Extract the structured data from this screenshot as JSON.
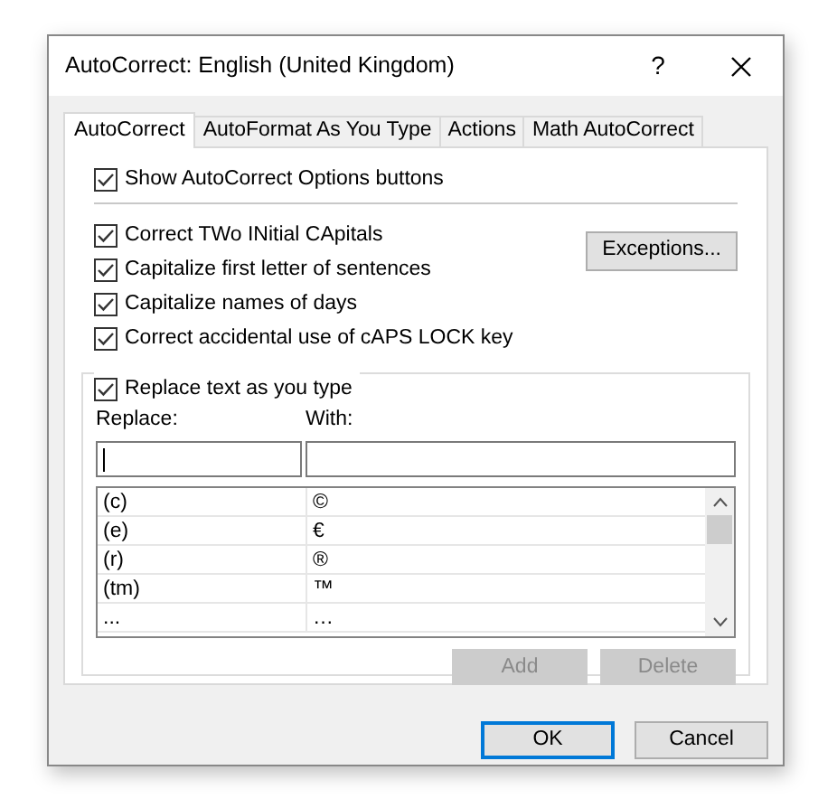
{
  "window": {
    "title": "AutoCorrect: English (United Kingdom)",
    "help": "?"
  },
  "tabs": [
    {
      "label": "AutoCorrect",
      "selected": true
    },
    {
      "label": "AutoFormat As You Type",
      "selected": false
    },
    {
      "label": "Actions",
      "selected": false
    },
    {
      "label": "Math AutoCorrect",
      "selected": false
    }
  ],
  "show_options": {
    "label": "Show AutoCorrect Options buttons",
    "checked": true
  },
  "options": [
    {
      "label": "Correct TWo INitial CApitals",
      "checked": true
    },
    {
      "label": "Capitalize first letter of sentences",
      "checked": true
    },
    {
      "label": "Capitalize names of days",
      "checked": true
    },
    {
      "label": "Correct accidental use of cAPS LOCK key",
      "checked": true
    }
  ],
  "exceptions_button": "Exceptions...",
  "replace_group": {
    "label": "Replace text as you type",
    "checked": true
  },
  "replace_label": "Replace:",
  "with_label": "With:",
  "entries": [
    {
      "replace": "(c)",
      "with": "©"
    },
    {
      "replace": "(e)",
      "with": "€"
    },
    {
      "replace": "(r)",
      "with": "®"
    },
    {
      "replace": "(tm)",
      "with": "™"
    },
    {
      "replace": "...",
      "with": "…"
    }
  ],
  "list_buttons": [
    {
      "label": "Add",
      "disabled": true
    },
    {
      "label": "Delete",
      "disabled": true
    }
  ],
  "buttons": [
    {
      "label": "OK",
      "default": true
    },
    {
      "label": "Cancel",
      "default": false
    }
  ]
}
